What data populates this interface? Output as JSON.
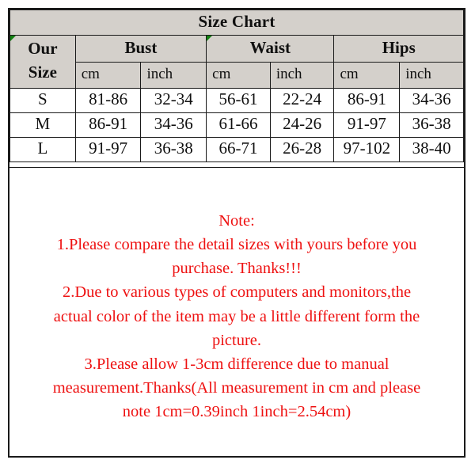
{
  "title": "Size Chart",
  "table": {
    "corner_label_lines": [
      "Our",
      "Size"
    ],
    "groups": [
      {
        "label": "Bust"
      },
      {
        "label": "Waist"
      },
      {
        "label": "Hips"
      }
    ],
    "units": [
      "cm",
      "inch",
      "cm",
      "inch",
      "cm",
      "inch"
    ],
    "rows": [
      {
        "size": "S",
        "values": [
          "81-86",
          "32-34",
          "56-61",
          "22-24",
          "86-91",
          "34-36"
        ]
      },
      {
        "size": "M",
        "values": [
          "86-91",
          "34-36",
          "61-66",
          "24-26",
          "91-97",
          "36-38"
        ]
      },
      {
        "size": "L",
        "values": [
          "91-97",
          "36-38",
          "66-71",
          "26-28",
          "97-102",
          "38-40"
        ]
      }
    ]
  },
  "note": {
    "heading": "Note:",
    "lines": [
      "1.Please compare the detail sizes with yours before you",
      "purchase. Thanks!!!",
      "2.Due to various types of computers and monitors,the",
      "actual color of the item may be a little different form the",
      "picture.",
      "3.Please allow 1-3cm difference due to manual",
      "measurement.Thanks(All measurement in cm and please",
      "note 1cm=0.39inch 1inch=2.54cm)"
    ]
  },
  "colors": {
    "header_background": "#d4d0cb",
    "border": "#1a1a1a",
    "note_text": "#ee1111",
    "marker_green": "#128012",
    "page_background": "#ffffff"
  },
  "markers": {
    "name": "comment-triangle-marker"
  }
}
